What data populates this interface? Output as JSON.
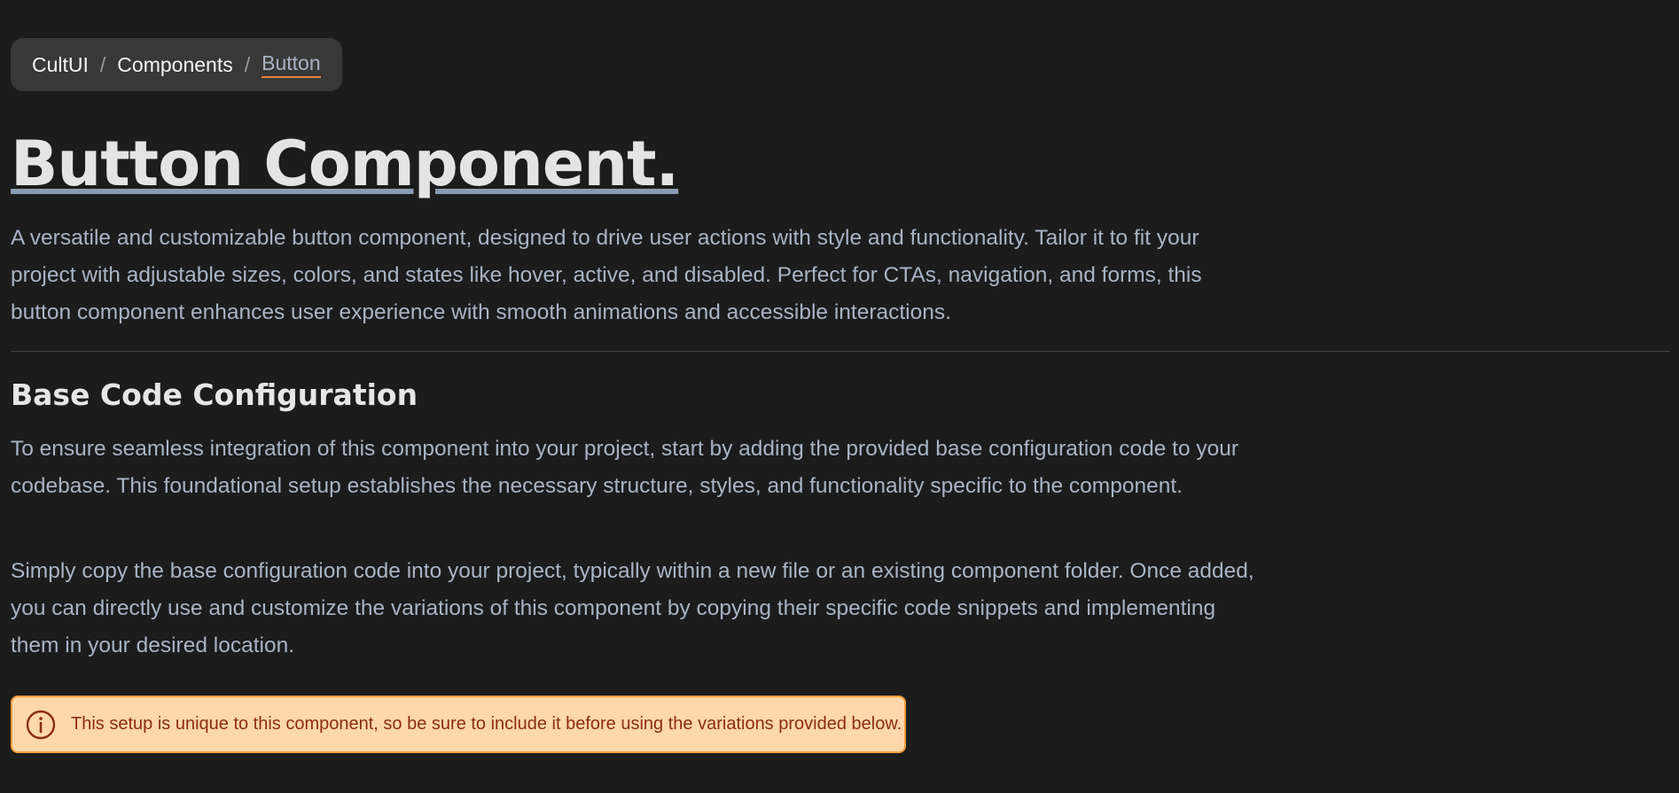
{
  "breadcrumb": {
    "items": [
      {
        "label": "CultUI"
      },
      {
        "label": "Components"
      },
      {
        "label": "Button"
      }
    ],
    "separator": "/"
  },
  "page": {
    "title": "Button Component.",
    "intro": "A versatile and customizable button component, designed to drive user actions with style and functionality. Tailor it to fit your project with adjustable sizes, colors, and states like hover, active, and disabled. Perfect for CTAs, navigation, and forms, this button component enhances user experience with smooth animations and accessible interactions."
  },
  "section": {
    "title": "Base Code Configuration",
    "paragraph1": "To ensure seamless integration of this component into your project, start by adding the provided base configuration code to your codebase. This foundational setup establishes the necessary structure, styles, and functionality specific to the component.",
    "paragraph2": "Simply copy the base configuration code into your project, typically within a new file or an existing component folder. Once added, you can directly use and customize the variations of this component by copying their specific code snippets and implementing them in your desired location."
  },
  "alert": {
    "icon": "info-circle-icon",
    "text": "This setup is unique to this component, so be sure to include it before using the variations provided below."
  },
  "colors": {
    "background": "#1c1c1c",
    "breadcrumb_bg": "#383838",
    "accent_underline": "#e8843a",
    "title_underline": "#8a9bb3",
    "alert_bg": "#fed7aa",
    "alert_border": "#f59e3b",
    "alert_text": "#8a2e12"
  }
}
